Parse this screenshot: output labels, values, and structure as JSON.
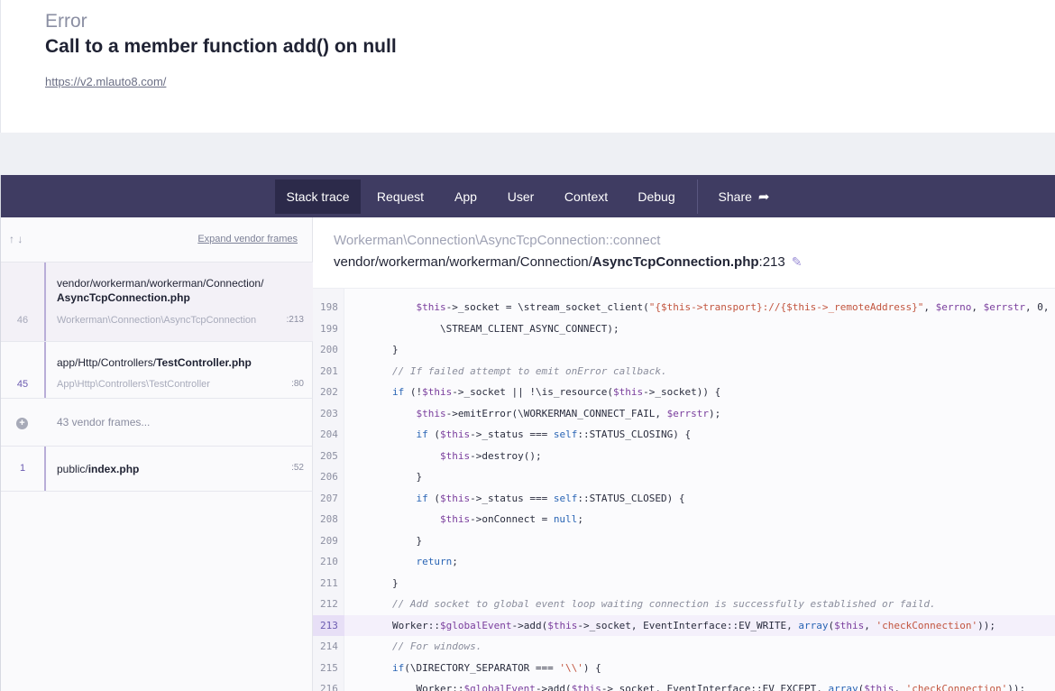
{
  "header": {
    "kind": "Error",
    "message": "Call to a member function add() on null",
    "url": "https://v2.mlauto8.com/"
  },
  "tabs": {
    "stack_trace": "Stack trace",
    "request": "Request",
    "app": "App",
    "user": "User",
    "context": "Context",
    "debug": "Debug",
    "share": "Share",
    "active": "Stack trace"
  },
  "sidebar": {
    "sort_icons": "↑ ↓",
    "expand_vendor": "Expand vendor frames",
    "frames": [
      {
        "number": "46",
        "path_dir": "vendor/workerman/workerman/Connection/",
        "path_file": "AsyncTcpConnection.php",
        "class": "Workerman\\Connection\\AsyncTcpConnection",
        "line": ":213"
      },
      {
        "number": "45",
        "path_dir": "app/Http/Controllers/",
        "path_file": "TestController.php",
        "class": "App\\Http\\Controllers\\TestController",
        "line": ":80"
      },
      {
        "label": "43 vendor frames..."
      },
      {
        "number": "1",
        "path_dir": "public/",
        "path_file": "index.php",
        "line": ":52"
      }
    ]
  },
  "location": {
    "class_method": "Workerman\\Connection\\AsyncTcpConnection::connect",
    "dir": "vendor/workerman/workerman/Connection/",
    "file": "AsyncTcpConnection.php",
    "line_suffix": ":213"
  },
  "code": {
    "highlight_line": 213,
    "lines": [
      {
        "n": "198",
        "text": "            $this->_socket = \\stream_socket_client(\"{$this->transport}://{$this->_remoteAddress}\", $errno, $errstr, 0,"
      },
      {
        "n": "199",
        "text": "                \\STREAM_CLIENT_ASYNC_CONNECT);"
      },
      {
        "n": "200",
        "text": "        }"
      },
      {
        "n": "201",
        "text": "        // If failed attempt to emit onError callback."
      },
      {
        "n": "202",
        "text": "        if (!$this->_socket || !\\is_resource($this->_socket)) {"
      },
      {
        "n": "203",
        "text": "            $this->emitError(\\WORKERMAN_CONNECT_FAIL, $errstr);"
      },
      {
        "n": "204",
        "text": "            if ($this->_status === self::STATUS_CLOSING) {"
      },
      {
        "n": "205",
        "text": "                $this->destroy();"
      },
      {
        "n": "206",
        "text": "            }"
      },
      {
        "n": "207",
        "text": "            if ($this->_status === self::STATUS_CLOSED) {"
      },
      {
        "n": "208",
        "text": "                $this->onConnect = null;"
      },
      {
        "n": "209",
        "text": "            }"
      },
      {
        "n": "210",
        "text": "            return;"
      },
      {
        "n": "211",
        "text": "        }"
      },
      {
        "n": "212",
        "text": "        // Add socket to global event loop waiting connection is successfully established or faild."
      },
      {
        "n": "213",
        "text": "        Worker::$globalEvent->add($this->_socket, EventInterface::EV_WRITE, array($this, 'checkConnection'));"
      },
      {
        "n": "214",
        "text": "        // For windows."
      },
      {
        "n": "215",
        "text": "        if(\\DIRECTORY_SEPARATOR === '\\\\') {"
      },
      {
        "n": "216",
        "text": "            Worker::$globalEvent->add($this->_socket, EventInterface::EV_EXCEPT, array($this, 'checkConnection'));"
      }
    ]
  },
  "colors": {
    "tabbar": "#3f3c62",
    "tab_active": "#2c2a4a",
    "accent": "#6b5bb0",
    "highlight": "#f4f0fb"
  }
}
